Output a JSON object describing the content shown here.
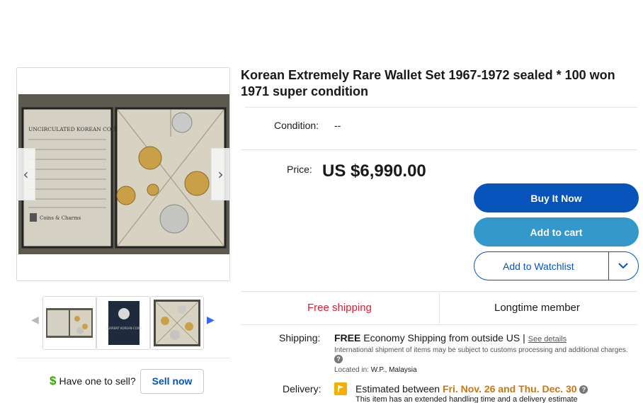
{
  "gallery": {
    "prev_arrow": "‹",
    "next_arrow": "›",
    "thumb_prev": "◀",
    "thumb_next": "▶",
    "photo_text": {
      "heading": "UNCIRCULATED KOREAN COINS",
      "brand": "Coins & Charms"
    },
    "thumb2_text": "CURRENT KOREAN COINS"
  },
  "sell": {
    "icon": "$",
    "question": "Have one to sell?",
    "button_label": "Sell now"
  },
  "item": {
    "title_line1": "Korean Extremely Rare Wallet Set 1967-1972 sealed * 100 won",
    "title_line2": "1971 super condition",
    "condition_label": "Condition:",
    "condition_value": "--",
    "price_label": "Price:",
    "price_value": "US $6,990.00"
  },
  "actions": {
    "buy_now": "Buy It Now",
    "add_to_cart": "Add to cart",
    "add_to_watchlist": "Add to Watchlist"
  },
  "badges": {
    "free_shipping": "Free shipping",
    "longtime_member": "Longtime member"
  },
  "shipping": {
    "label": "Shipping:",
    "free": "FREE",
    "method": "Economy Shipping from outside US |",
    "see_details": "See details",
    "note": "International shipment of items may be subject to customs processing and additional charges.",
    "help": "?",
    "located_label": "Located in:",
    "located_value": "W.P., Malaysia"
  },
  "delivery": {
    "label": "Delivery:",
    "estimated_prefix": "Estimated between",
    "dates": "Fri. Nov. 26 and Thu. Dec. 30",
    "help": "?",
    "note": "This item has an extended handling time and a delivery estimate"
  },
  "colors": {
    "primary": "#0654ba",
    "secondary": "#3498ca",
    "free_shipping": "#dd1e31",
    "delivery_dates": "#c8770e",
    "sell_icon": "#37a600"
  }
}
